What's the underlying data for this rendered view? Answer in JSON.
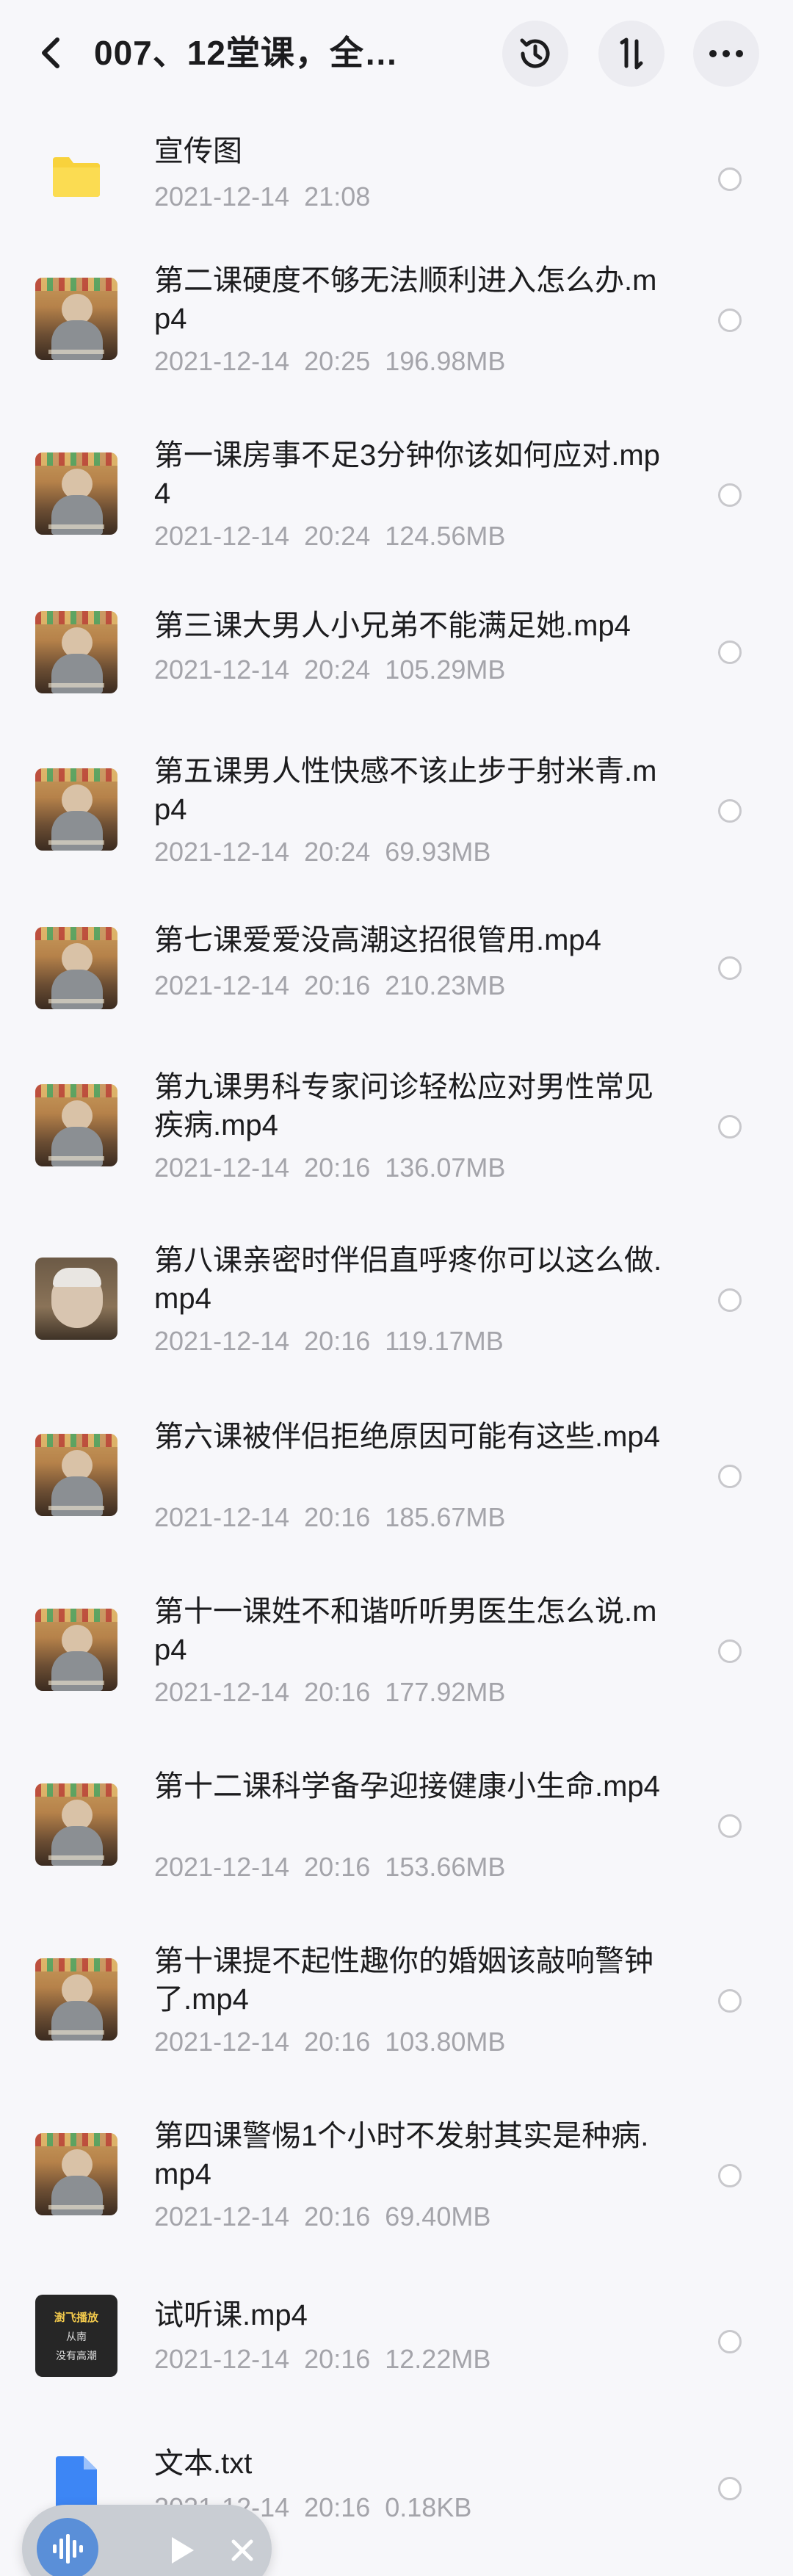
{
  "header": {
    "title": "007、12堂课，全…"
  },
  "files": [
    {
      "name": "宣传图",
      "date": "2021-12-14  21:08",
      "size": "",
      "type": "folder"
    },
    {
      "name": "第二课硬度不够无法顺利进入怎么办.mp4",
      "date": "2021-12-14  20:25",
      "size": "196.98MB",
      "type": "video"
    },
    {
      "name": "第一课房事不足3分钟你该如何应对.mp4",
      "date": "2021-12-14  20:24",
      "size": "124.56MB",
      "type": "video"
    },
    {
      "name": "第三课大男人小兄弟不能满足她.mp4",
      "date": "2021-12-14  20:24",
      "size": "105.29MB",
      "type": "video"
    },
    {
      "name": "第五课男人性快感不该止步于射米青.mp4",
      "date": "2021-12-14  20:24",
      "size": "69.93MB",
      "type": "video"
    },
    {
      "name": "第七课爱爱没高潮这招很管用.mp4",
      "date": "2021-12-14  20:16",
      "size": "210.23MB",
      "type": "video"
    },
    {
      "name": "第九课男科专家问诊轻松应对男性常见疾病.mp4",
      "date": "2021-12-14  20:16",
      "size": "136.07MB",
      "type": "video"
    },
    {
      "name": "第八课亲密时伴侣直呼疼你可以这么做.mp4",
      "date": "2021-12-14  20:16",
      "size": "119.17MB",
      "type": "closeup"
    },
    {
      "name": "第六课被伴侣拒绝原因可能有这些.mp4",
      "date": "2021-12-14  20:16",
      "size": "185.67MB",
      "type": "video"
    },
    {
      "name": "第十一课姓不和谐听听男医生怎么说.mp4",
      "date": "2021-12-14  20:16",
      "size": "177.92MB",
      "type": "video"
    },
    {
      "name": "第十二课科学备孕迎接健康小生命.mp4",
      "date": "2021-12-14  20:16",
      "size": "153.66MB",
      "type": "video"
    },
    {
      "name": "第十课提不起性趣你的婚姻该敲响警钟了.mp4",
      "date": "2021-12-14  20:16",
      "size": "103.80MB",
      "type": "video"
    },
    {
      "name": "第四课警惕1个小时不发射其实是种病.mp4",
      "date": "2021-12-14  20:16",
      "size": "69.40MB",
      "type": "video"
    },
    {
      "name": "试听课.mp4",
      "date": "2021-12-14  20:16",
      "size": "12.22MB",
      "type": "dark",
      "thumb_text_1": "澍飞播放",
      "thumb_text_2": "从南",
      "thumb_text_3": "没有高潮"
    },
    {
      "name": "文本.txt",
      "date": "2021-12-14  20:16",
      "size": "0.18KB",
      "type": "doc"
    }
  ],
  "icons": {
    "header": [
      "back-icon",
      "history-icon",
      "sort-icon",
      "more-icon"
    ],
    "player": [
      "waveform-icon",
      "play-icon",
      "close-icon"
    ]
  },
  "colors": {
    "folder": "#f8d23c",
    "doc": "#3d86f5",
    "meta_text": "#a4a4aa",
    "background": "#f7f7fa",
    "player_wave": "#5a8fd8"
  }
}
